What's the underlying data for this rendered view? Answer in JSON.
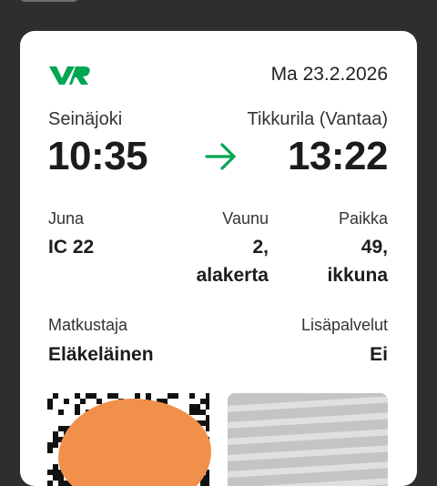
{
  "ticket": {
    "date": "Ma 23.2.2026",
    "from_station": "Seinäjoki",
    "to_station": "Tikkurila (Vantaa)",
    "departure_time": "10:35",
    "arrival_time": "13:22",
    "train_label": "Juna",
    "train_value": "IC 22",
    "car_label": "Vaunu",
    "car_value_line1": "2,",
    "car_value_line2": "alakerta",
    "seat_label": "Paikka",
    "seat_value_line1": "49,",
    "seat_value_line2": "ikkuna",
    "passenger_label": "Matkustaja",
    "passenger_value": "Eläkeläinen",
    "extras_label": "Lisäpalvelut",
    "extras_value": "Ei"
  },
  "brand": {
    "logo_icon": "vr-logo-icon",
    "accent": "#00a651"
  },
  "icons": {
    "arrow": "arrow-right-icon"
  }
}
